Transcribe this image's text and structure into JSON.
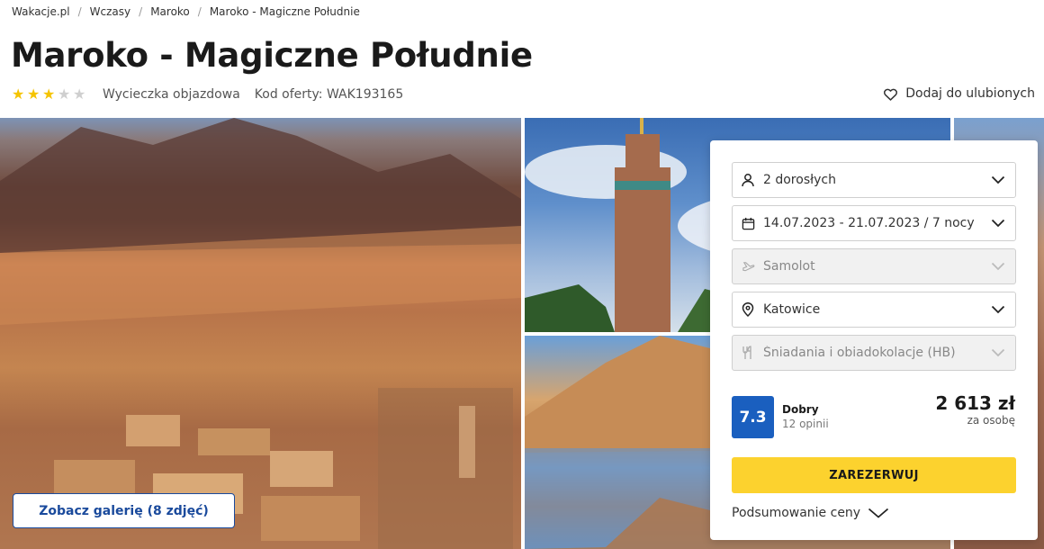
{
  "breadcrumb": [
    "Wakacje.pl",
    "Wczasy",
    "Maroko",
    "Maroko - Magiczne Południe"
  ],
  "title": "Maroko - Magiczne Południe",
  "rating_stars": {
    "filled": 3,
    "total": 5
  },
  "trip_type": "Wycieczka objazdowa",
  "offer_code": "Kod oferty: WAK193165",
  "favorite_label": "Dodaj do ulubionych",
  "gallery_button": "Zobacz galerię (8 zdjęć)",
  "booking": {
    "travelers": "2 dorosłych",
    "dates": "14.07.2023 - 21.07.2023 / 7 nocy",
    "transport": "Samolot",
    "departure": "Katowice",
    "board": "Śniadania i obiadokolacje (HB)",
    "score": "7.3",
    "score_label": "Dobry",
    "reviews": "12 opinii",
    "price": "2 613 zł",
    "price_unit": "za osobę",
    "book_label": "ZAREZERWUJ",
    "summary_label": "Podsumowanie ceny"
  },
  "colors": {
    "accent_yellow": "#fcd22e",
    "score_blue": "#1a5fbf",
    "link_blue": "#1a4a9c",
    "star": "#f5c400"
  }
}
